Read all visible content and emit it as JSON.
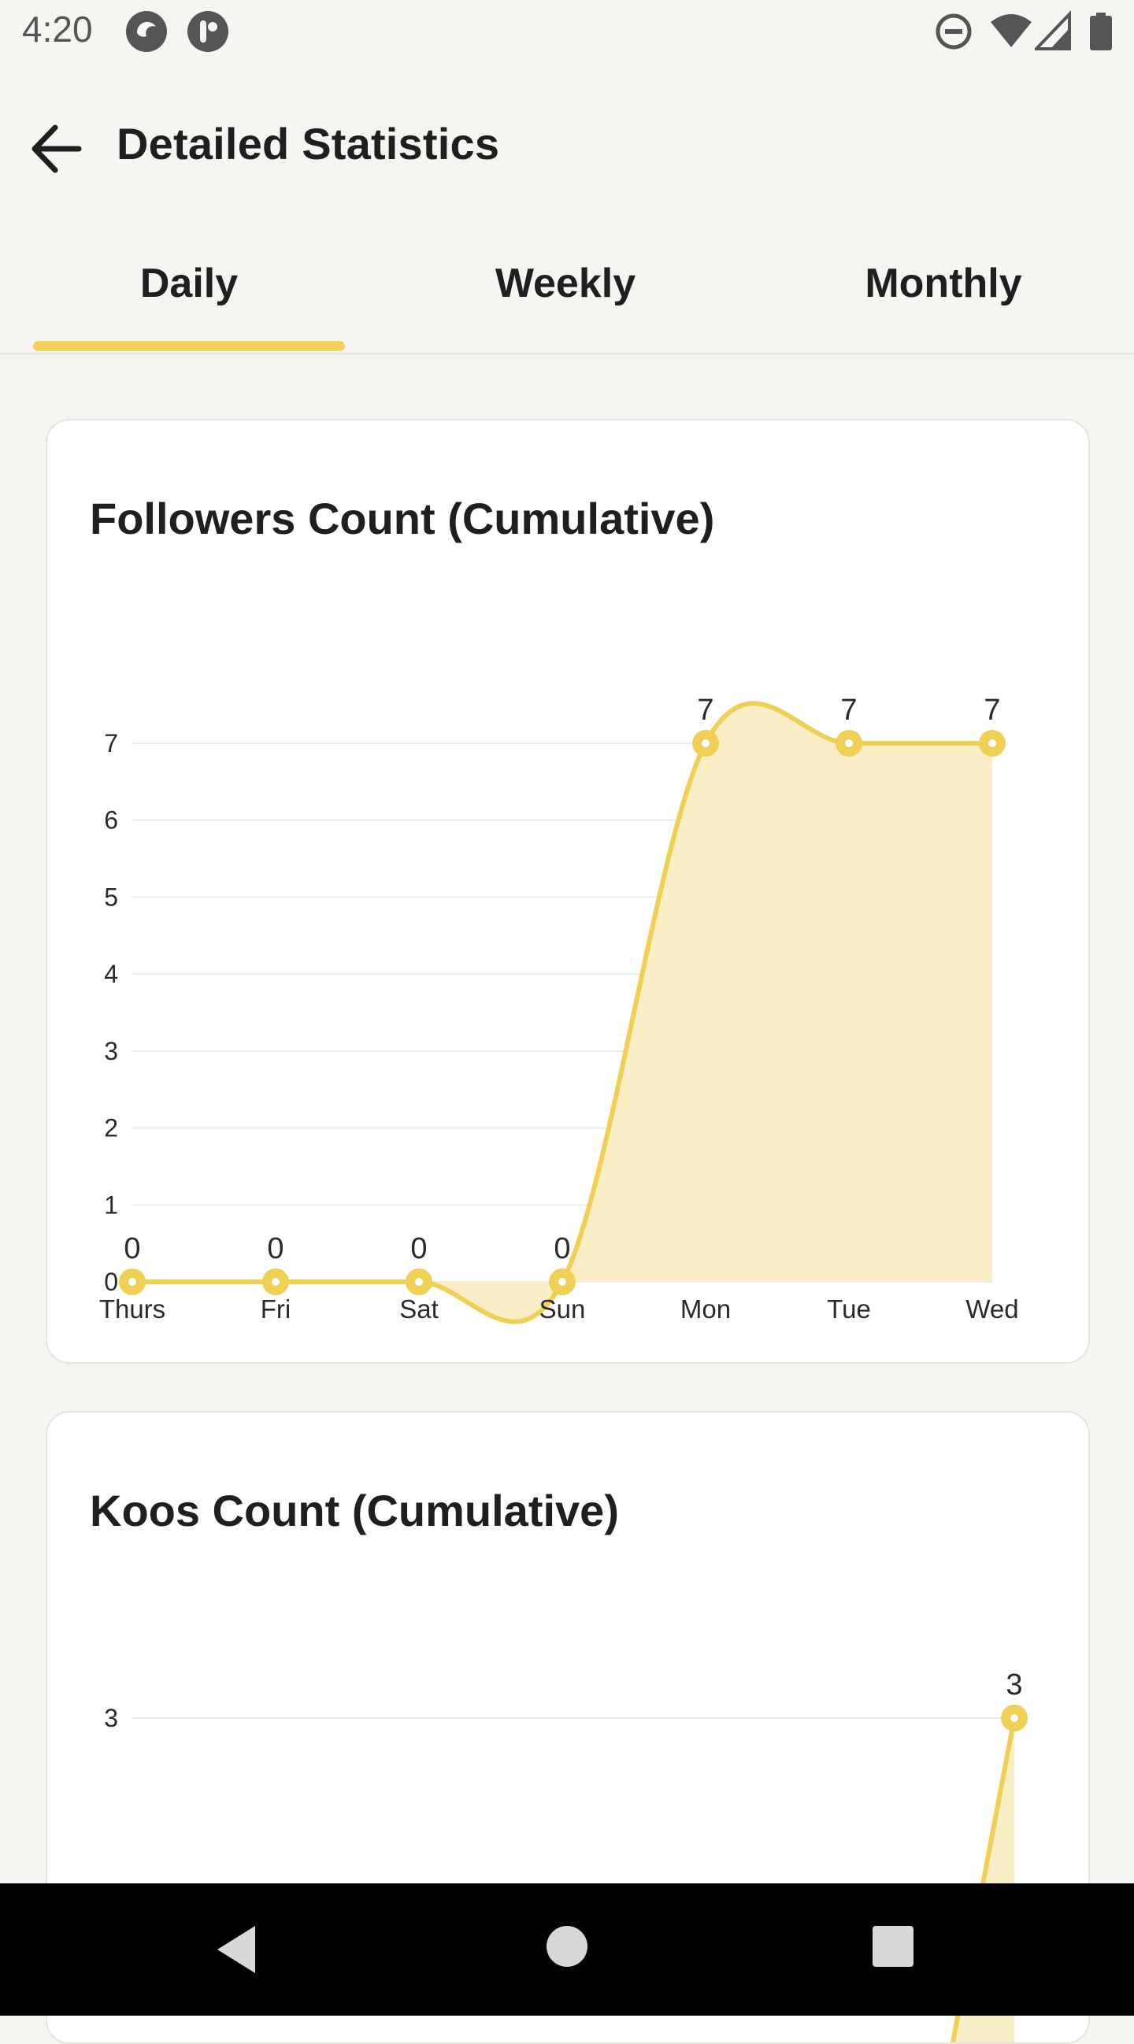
{
  "status_bar": {
    "time": "4:20",
    "app_icons": [
      "app-icon-1",
      "app-icon-2"
    ],
    "right_icons": [
      "do-not-disturb-icon",
      "wifi-icon",
      "signal-icon",
      "battery-icon"
    ]
  },
  "header": {
    "title": "Detailed Statistics",
    "back_icon": "arrow-left-icon"
  },
  "tabs": [
    {
      "label": "Daily",
      "selected": true
    },
    {
      "label": "Weekly",
      "selected": false
    },
    {
      "label": "Monthly",
      "selected": false
    }
  ],
  "colors": {
    "accent": "#f1d35c",
    "line": "#f0cf55",
    "fill": "#f9eec6",
    "grid": "#ececec"
  },
  "cards": [
    {
      "title": "Followers Count (Cumulative)"
    },
    {
      "title": "Koos Count (Cumulative)"
    }
  ],
  "chart_data": [
    {
      "type": "area",
      "title": "Followers Count (Cumulative)",
      "categories": [
        "Thurs",
        "Fri",
        "Sat",
        "Sun",
        "Mon",
        "Tue",
        "Wed"
      ],
      "values": [
        0,
        0,
        0,
        0,
        7,
        7,
        7
      ],
      "yticks": [
        0,
        1,
        2,
        3,
        4,
        5,
        6,
        7
      ],
      "ylim": [
        0,
        7
      ],
      "grid": true
    },
    {
      "type": "area",
      "title": "Koos Count (Cumulative)",
      "yticks": [
        3
      ],
      "visible_last_value": 3,
      "grid": true
    }
  ],
  "nav_bar": {
    "buttons": [
      "back-nav-icon",
      "home-nav-icon",
      "recents-nav-icon"
    ]
  }
}
